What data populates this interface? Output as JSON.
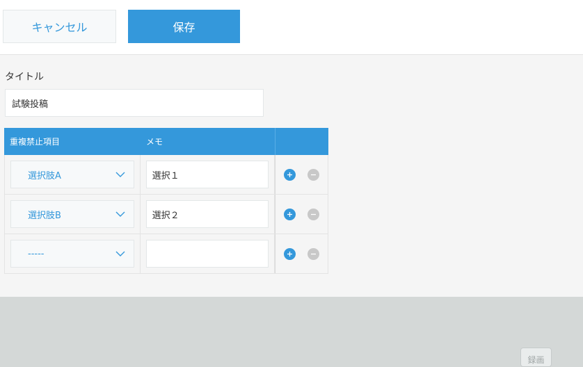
{
  "toolbar": {
    "cancel_label": "キャンセル",
    "save_label": "保存"
  },
  "form": {
    "title_label": "タイトル",
    "title_value": "試験投稿",
    "table": {
      "headers": [
        "重複禁止項目",
        "メモ"
      ],
      "rows": [
        {
          "select": "選択肢A",
          "memo": "選択１"
        },
        {
          "select": "選択肢B",
          "memo": "選択２"
        },
        {
          "select": "-----",
          "memo": ""
        }
      ]
    }
  },
  "footer": {
    "record_label": "録画"
  },
  "colors": {
    "accent": "#3498db",
    "background": "#f5f5f5",
    "footer_bg": "#d4d8d7"
  }
}
